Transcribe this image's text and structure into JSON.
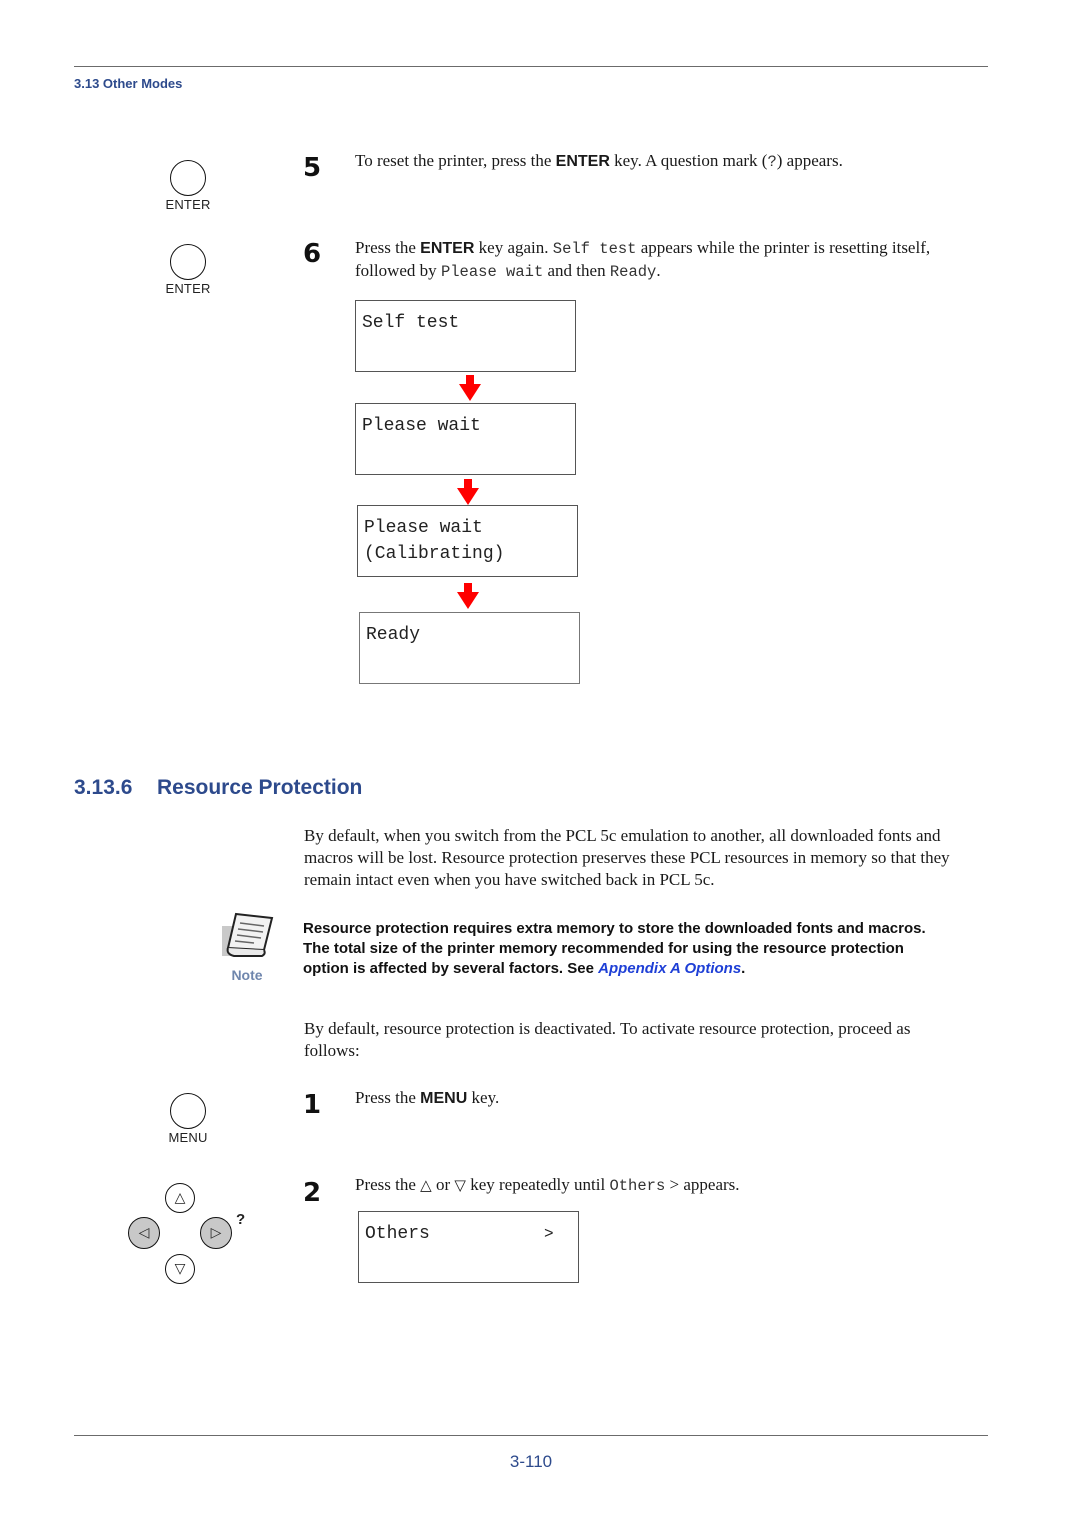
{
  "header": {
    "section": "3.13 Other Modes"
  },
  "steps_top": [
    {
      "number": "5",
      "key_label": "ENTER",
      "text_before": "To reset the printer, press the ",
      "key": "ENTER",
      "text_after": " key. A question mark (",
      "mono": "?",
      "text_end": ") appears."
    },
    {
      "number": "6",
      "key_label": "ENTER",
      "text_before": "Press the ",
      "key": "ENTER",
      "text_mid1": " key again. ",
      "mono1": "Self test",
      "text_mid2": " appears while the printer is resetting itself,",
      "text_line2_a": "followed by ",
      "mono2": "Please wait",
      "text_line2_b": " and then ",
      "mono3": "Ready",
      "text_line2_c": "."
    }
  ],
  "lcd_sequence": [
    {
      "line1": "Self test",
      "line2": ""
    },
    {
      "line1": "Please wait",
      "line2": ""
    },
    {
      "line1": "Please wait",
      "line2": "(Calibrating)"
    },
    {
      "line1": "Ready",
      "line2": ""
    }
  ],
  "section": {
    "number": "3.13.6",
    "title": "Resource Protection",
    "intro_lines": [
      "By default, when you switch from the PCL 5c emulation to another, all downloaded fonts and",
      "macros will be lost. Resource protection preserves these PCL resources in memory so that they",
      "remain intact even when you have switched back in PCL 5c."
    ],
    "note": {
      "label": "Note",
      "line1": "Resource protection requires extra memory to store the downloaded fonts and macros.",
      "line2": "The total size of the printer memory recommended for using the resource protection",
      "line3_before": "option is affected by several factors. See ",
      "link": "Appendix A Options",
      "line3_after": "."
    },
    "activate_lines": [
      "By default, resource protection is deactivated. To activate resource protection, proceed as",
      "follows:"
    ],
    "steps": [
      {
        "number": "1",
        "key_label": "MENU",
        "text_before": "Press the ",
        "key": "MENU",
        "text_after": " key."
      },
      {
        "number": "2",
        "text_before": "Press the ",
        "up_symbol": "△",
        "text_or": " or ",
        "down_symbol": "▽",
        "text_mid": " key repeatedly until ",
        "mono": "Others",
        "text_after": " > appears.",
        "lcd": {
          "line1": "Others",
          "right": ">"
        }
      }
    ],
    "dpad": {
      "up": "△",
      "down": "▽",
      "left": "◁",
      "right": "▷",
      "question": "?"
    }
  },
  "footer": {
    "page_number": "3-110"
  }
}
